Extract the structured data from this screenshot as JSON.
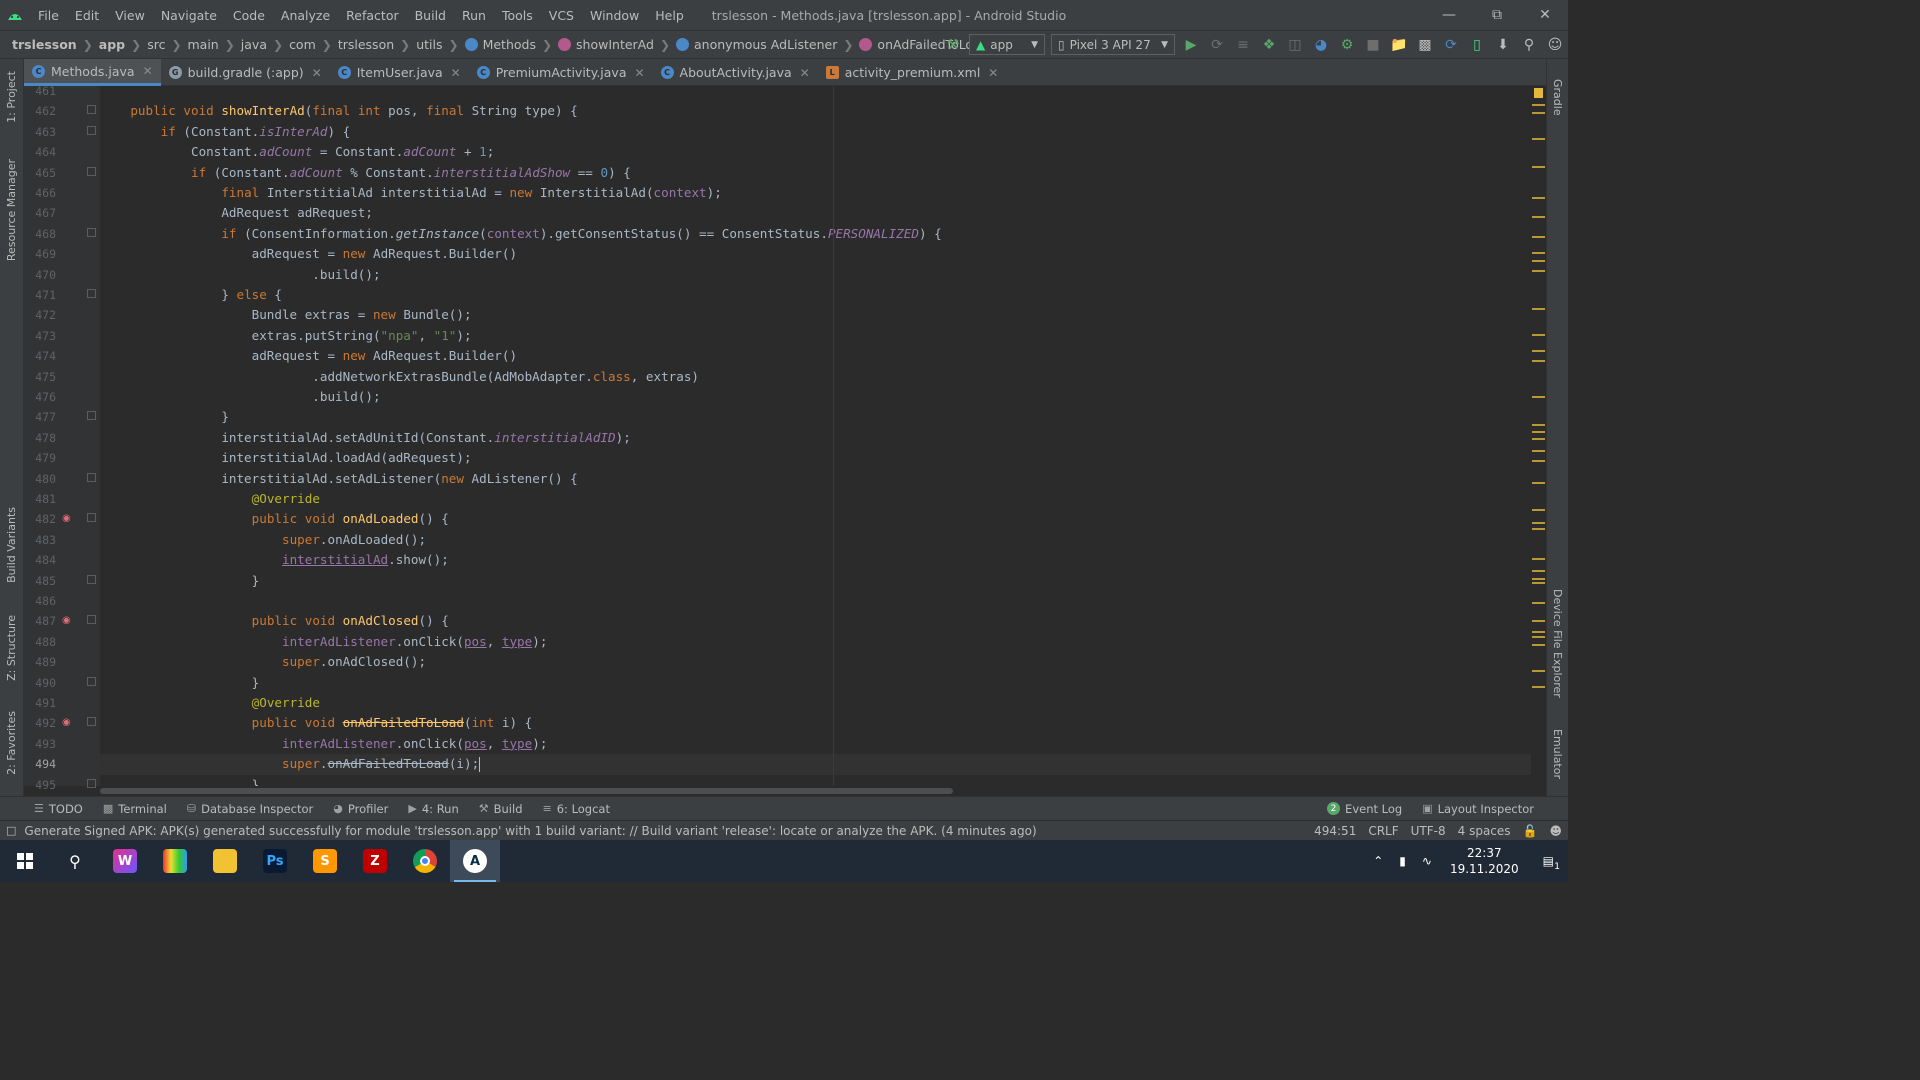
{
  "menu": {
    "items": [
      "File",
      "Edit",
      "View",
      "Navigate",
      "Code",
      "Analyze",
      "Refactor",
      "Build",
      "Run",
      "Tools",
      "VCS",
      "Window",
      "Help"
    ],
    "window_title": "trslesson - Methods.java [trslesson.app] - Android Studio"
  },
  "breadcrumbs": [
    "trslesson",
    "app",
    "src",
    "main",
    "java",
    "com",
    "trslesson",
    "utils",
    "Methods",
    "showInterAd",
    "anonymous AdListener",
    "onAdFailedToLoad"
  ],
  "toolbar": {
    "run_config": "app",
    "device": "Pixel 3 API 27"
  },
  "tabs": [
    {
      "label": "Methods.java",
      "icon": "class-icon",
      "color": "#4a88c7",
      "active": true
    },
    {
      "label": "build.gradle (:app)",
      "icon": "gradle-icon",
      "color": "#8a9aa8",
      "active": false
    },
    {
      "label": "ItemUser.java",
      "icon": "class-icon",
      "color": "#4a88c7",
      "active": false
    },
    {
      "label": "PremiumActivity.java",
      "icon": "class-icon",
      "color": "#4a88c7",
      "active": false
    },
    {
      "label": "AboutActivity.java",
      "icon": "class-icon",
      "color": "#4a88c7",
      "active": false
    },
    {
      "label": "activity_premium.xml",
      "icon": "layout-icon",
      "color": "#c97a3b",
      "active": false
    }
  ],
  "side_tools": {
    "left": [
      "1: Project",
      "Resource Manager",
      "Build Variants",
      "Z: Structure",
      "2: Favorites"
    ],
    "right": [
      "Gradle",
      "Device File Explorer",
      "Emulator"
    ]
  },
  "editor": {
    "line_numbers": [
      "461",
      "462",
      "463",
      "464",
      "465",
      "466",
      "467",
      "468",
      "469",
      "470",
      "471",
      "472",
      "473",
      "474",
      "475",
      "476",
      "477",
      "478",
      "479",
      "480",
      "481",
      "482",
      "483",
      "484",
      "485",
      "486",
      "487",
      "488",
      "489",
      "490",
      "491",
      "492",
      "493",
      "494",
      "495"
    ],
    "current_line": "494"
  },
  "bottom_tools": {
    "left": [
      "TODO",
      "Terminal",
      "Database Inspector",
      "Profiler",
      "4: Run",
      "Build",
      "6: Logcat"
    ],
    "right": [
      "Event Log",
      "Layout Inspector"
    ],
    "event_log_count": "2"
  },
  "status": {
    "message": "Generate Signed APK: APK(s) generated successfully for module 'trslesson.app' with 1 build variant: // Build variant 'release': locate or analyze the APK. (4 minutes ago)",
    "position": "494:51",
    "line_sep": "CRLF",
    "encoding": "UTF-8",
    "indent": "4 spaces"
  },
  "taskbar": {
    "time": "22:37",
    "date": "19.11.2020",
    "notifications": "1"
  },
  "colors": {
    "accent": "#4a88c7",
    "warning_marker": "#b99838",
    "run_green": "#59a869"
  }
}
